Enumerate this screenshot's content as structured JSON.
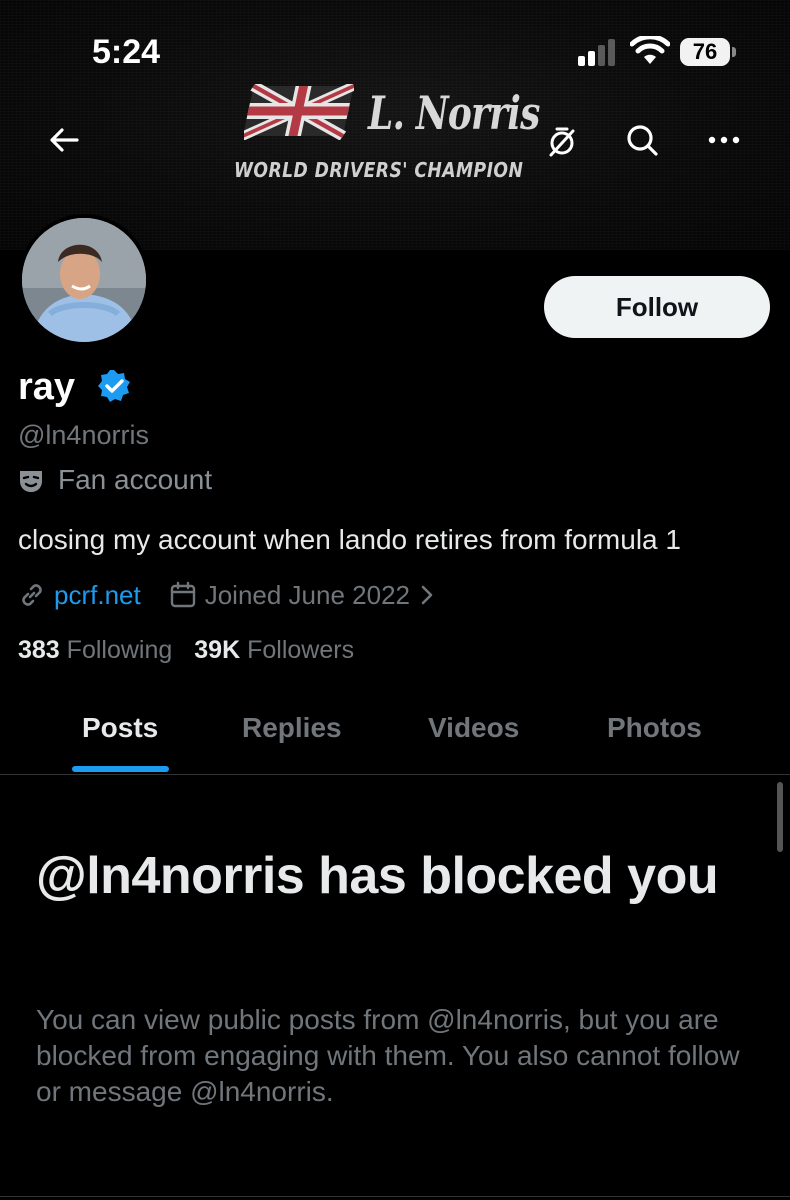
{
  "status_bar": {
    "time": "5:24",
    "battery": "76"
  },
  "banner": {
    "logo_name": "L. Norris",
    "logo_subtitle": "WORLD DRIVERS' CHAMPION"
  },
  "nav": {
    "back_icon": "back-arrow-icon",
    "dnd_icon": "notifications-off-icon",
    "search_icon": "search-icon",
    "more_icon": "more-icon"
  },
  "profile": {
    "display_name": "ray",
    "handle": "@ln4norris",
    "label": "Fan account",
    "bio": "closing my account when lando retires from formula 1",
    "link": "pcrf.net",
    "joined": "Joined June 2022",
    "following_count": "383",
    "following_label": "Following",
    "followers_count": "39K",
    "followers_label": "Followers"
  },
  "actions": {
    "follow_label": "Follow"
  },
  "tabs": [
    {
      "label": "Posts",
      "active": true
    },
    {
      "label": "Replies",
      "active": false
    },
    {
      "label": "Videos",
      "active": false
    },
    {
      "label": "Photos",
      "active": false
    }
  ],
  "blocked": {
    "title": "@ln4norris has blocked you",
    "body": "You can view public posts from @ln4norris, but you are blocked from engaging with them. You also cannot follow or message @ln4norris."
  },
  "colors": {
    "accent": "#1d9bf0",
    "background": "#000000",
    "muted_text": "#71767b"
  }
}
